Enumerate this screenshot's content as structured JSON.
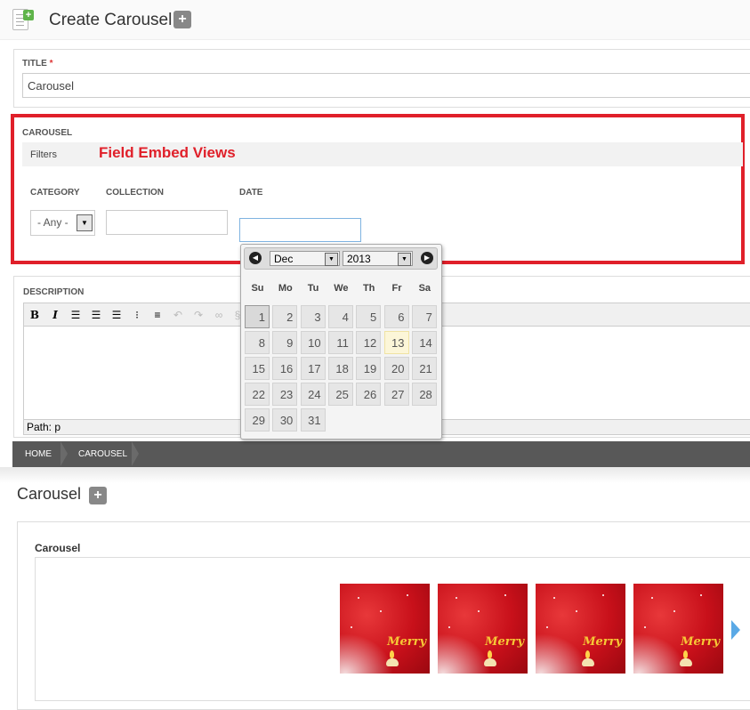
{
  "header": {
    "title": "Create Carousel",
    "add_label": "+"
  },
  "title_field": {
    "label": "TITLE",
    "required_mark": "*",
    "value": "Carousel"
  },
  "carousel_field": {
    "label": "CAROUSEL",
    "filters_label": "Filters",
    "annotation": "Field Embed Views",
    "annotation_color": "#e0202a",
    "category": {
      "label": "CATEGORY",
      "value": "- Any -"
    },
    "collection": {
      "label": "COLLECTION",
      "value": ""
    },
    "date": {
      "label": "DATE",
      "value": ""
    }
  },
  "datepicker": {
    "month": "Dec",
    "year": "2013",
    "weekdays": [
      "Su",
      "Mo",
      "Tu",
      "We",
      "Th",
      "Fr",
      "Sa"
    ],
    "days": [
      "1",
      "2",
      "3",
      "4",
      "5",
      "6",
      "7",
      "8",
      "9",
      "10",
      "11",
      "12",
      "13",
      "14",
      "15",
      "16",
      "17",
      "18",
      "19",
      "20",
      "21",
      "22",
      "23",
      "24",
      "25",
      "26",
      "27",
      "28",
      "29",
      "30",
      "31"
    ],
    "first_weekday_index": 0,
    "selected_day": 1,
    "today": 13,
    "icons": {
      "prev": "prev-circle-icon",
      "next": "next-circle-icon"
    }
  },
  "description_field": {
    "label": "DESCRIPTION",
    "toolbar": [
      "bold-icon",
      "italic-icon",
      "align-left-icon",
      "align-center-icon",
      "align-right-icon",
      "bullet-list-icon",
      "numbered-list-icon",
      "undo-icon",
      "redo-icon",
      "link-icon",
      "unlink-icon"
    ],
    "path": "Path: p"
  },
  "breadcrumb": {
    "items": [
      "HOME",
      "CAROUSEL"
    ]
  },
  "section": {
    "title": "Carousel",
    "add_label": "+"
  },
  "carousel_view": {
    "name": "Carousel",
    "slides": [
      {
        "caption": "Merry"
      },
      {
        "caption": "Merry"
      },
      {
        "caption": "Merry"
      },
      {
        "caption": "Merry"
      }
    ]
  },
  "colors": {
    "highlight_border": "#e0202a",
    "breadcrumb_bg": "#585858",
    "slide_red": "#c8101a",
    "arrow": "#5aa9e6"
  }
}
